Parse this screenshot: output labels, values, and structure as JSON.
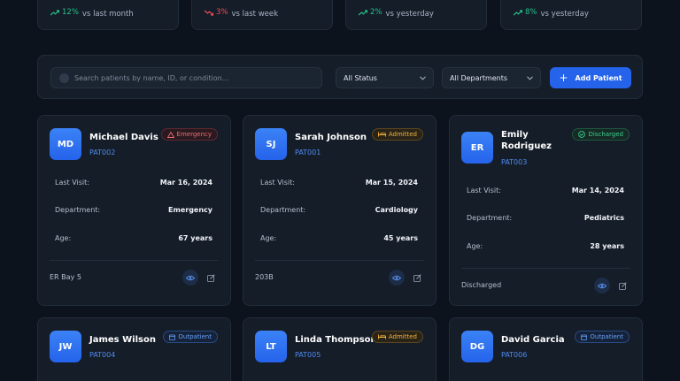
{
  "stats": [
    {
      "change": "12%",
      "direction": "up",
      "text": "vs last month"
    },
    {
      "change": "3%",
      "direction": "down",
      "text": "vs last week"
    },
    {
      "change": "2%",
      "direction": "up",
      "text": "vs yesterday"
    },
    {
      "change": "8%",
      "direction": "up",
      "text": "vs yesterday"
    }
  ],
  "toolbar": {
    "search_placeholder": "Search patients by name, ID, or condition...",
    "status_filter": "All Status",
    "department_filter": "All Departments",
    "add_label": "Add Patient"
  },
  "labels": {
    "last_visit": "Last Visit:",
    "department": "Department:",
    "age": "Age:"
  },
  "patients": [
    {
      "initials": "MD",
      "name": "Michael Davis",
      "id": "PAT002",
      "status": "Emergency",
      "last_visit": "Mar 16, 2024",
      "department": "Emergency",
      "age": "67 years",
      "location": "ER Bay 5"
    },
    {
      "initials": "SJ",
      "name": "Sarah Johnson",
      "id": "PAT001",
      "status": "Admitted",
      "last_visit": "Mar 15, 2024",
      "department": "Cardiology",
      "age": "45 years",
      "location": "203B"
    },
    {
      "initials": "ER",
      "name": "Emily Rodriguez",
      "name_line1": "Emily",
      "name_line2": "Rodriguez",
      "id": "PAT003",
      "status": "Discharged",
      "last_visit": "Mar 14, 2024",
      "department": "Pediatrics",
      "age": "28 years",
      "location": "Discharged"
    },
    {
      "initials": "JW",
      "name": "James Wilson",
      "id": "PAT004",
      "status": "Outpatient"
    },
    {
      "initials": "LT",
      "name": "Linda Thompson",
      "id": "PAT005",
      "status": "Admitted"
    },
    {
      "initials": "DG",
      "name": "David Garcia",
      "id": "PAT006",
      "status": "Outpatient"
    }
  ],
  "colors": {
    "background": "#0d131d",
    "card": "#151d29",
    "accent": "#2563eb",
    "up": "#27c08a",
    "down": "#ef4f55"
  }
}
